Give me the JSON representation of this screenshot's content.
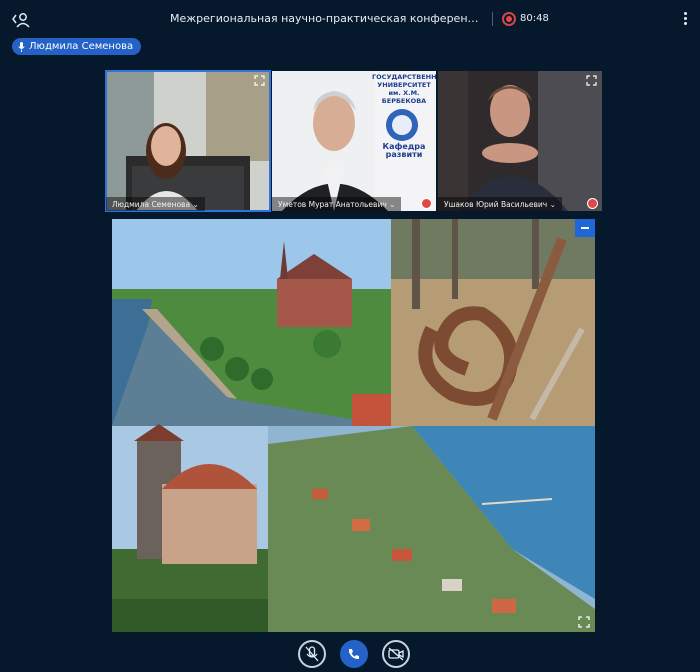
{
  "header": {
    "title": "Межрегиональная научно-практическая конференция \"Постковидная р...",
    "recording_time": "80:48"
  },
  "speaker_pill": {
    "label": "Людмила Семенова"
  },
  "participants": [
    {
      "name": "Людмила Семенова",
      "muted": false,
      "active": true
    },
    {
      "name": "Уметов Мурат Анатольевич",
      "muted": true,
      "active": false,
      "backdrop_text": "ГОСУДАРСТВЕНН\nУНИВЕРСИТЕТ\nим. Х.М. БЕРБЕКОВА\nКафедра\nразвити"
    },
    {
      "name": "Ушаков Юрий Васильевич",
      "muted": true,
      "active": false
    }
  ],
  "backdrop": {
    "line1": "ГОСУДАРСТВЕНН",
    "line2": "УНИВЕРСИТЕТ",
    "line3": "им. Х.М. БЕРБЕКОВА",
    "line4": "Кафедра",
    "line5": "развити"
  },
  "presentation": {
    "photos": [
      "cathedral-river",
      "dancing-forest",
      "tower-house",
      "seaside-town"
    ]
  },
  "colors": {
    "background": "#06182c",
    "accent": "#2462c7",
    "recording": "#e04848"
  },
  "controls": [
    "mic-off-icon",
    "phone-icon",
    "camera-off-icon"
  ]
}
